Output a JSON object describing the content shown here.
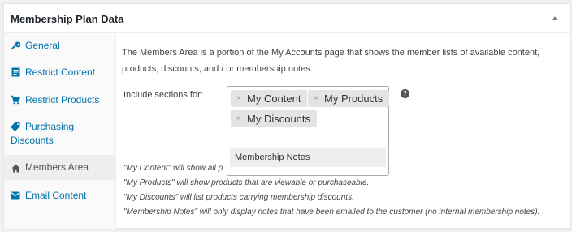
{
  "panel": {
    "title": "Membership Plan Data"
  },
  "tabs": [
    {
      "label": "General",
      "icon": "wrench-icon"
    },
    {
      "label": "Restrict Content",
      "icon": "document-icon"
    },
    {
      "label": "Restrict Products",
      "icon": "cart-icon"
    },
    {
      "label": "Purchasing",
      "label2": "Discounts",
      "icon": "tag-icon"
    },
    {
      "label": "Members Area",
      "icon": "home-icon",
      "active": true
    },
    {
      "label": "Email Content",
      "icon": "envelope-icon"
    }
  ],
  "members_area": {
    "description": "The Members Area is a portion of the My Accounts page that shows the member lists of available content, products, discounts, and / or membership notes.",
    "field_label": "Include sections for:",
    "selected": [
      "My Content",
      "My Products",
      "My Discounts"
    ],
    "dropdown_option": "Membership Notes",
    "remove_glyph": "×",
    "help_glyph": "?",
    "notes": [
      "\"My Content\" will show all p",
      "\"My Products\" will show products that are viewable or purchaseable.",
      "\"My Discounts\" will list products carrying membership discounts.",
      "\"Membership Notes\" will only display notes that have been emailed to the customer (no internal membership notes)."
    ]
  },
  "colors": {
    "link": "#0073aa",
    "active_tab_bg": "#eeeeee",
    "chip_bg": "#e4e4e4"
  }
}
